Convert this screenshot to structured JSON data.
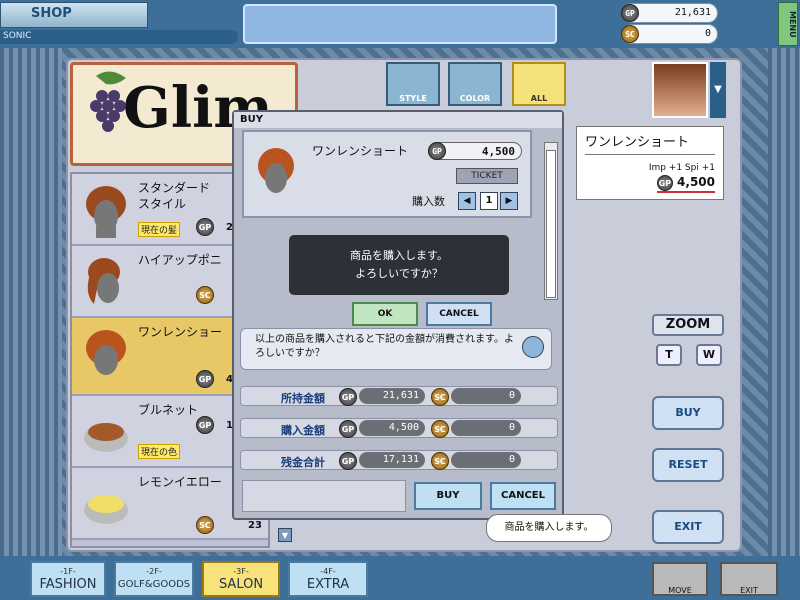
{
  "topbar": {
    "shop_label": "SHOP",
    "player_name": "SONIC",
    "menu_label": "MENU",
    "gp_label": "GP",
    "gp_value": "21,631",
    "sc_label": "SC",
    "sc_value": "0"
  },
  "title_card": {
    "text": "Glim"
  },
  "tabs": [
    {
      "label": "STYLE"
    },
    {
      "label": "COLOR"
    },
    {
      "label": "ALL"
    }
  ],
  "items": [
    {
      "name": "スタンダード\nスタイル",
      "badge": "現在の髪",
      "coin": "GP",
      "price": "2"
    },
    {
      "name": "ハイアップポニ",
      "badge": "",
      "coin": "SC",
      "price": ""
    },
    {
      "name": "ワンレンショー",
      "badge": "",
      "coin": "GP",
      "price": "4"
    },
    {
      "name": "ブルネット",
      "badge": "現在の色",
      "coin": "GP",
      "price": "1"
    },
    {
      "name": "レモンイエロー",
      "badge": "",
      "coin": "SC",
      "price": "23"
    }
  ],
  "info_card": {
    "name": "ワンレンショート",
    "stats": "Imp +1 Spi +1",
    "coin": "GP",
    "price": "4,500"
  },
  "right": {
    "zoom": "ZOOM",
    "t": "T",
    "w": "W",
    "buy": "BUY",
    "reset": "RESET",
    "exit": "EXIT"
  },
  "dialog": {
    "title": "BUY",
    "product_name": "ワンレンショート",
    "coin": "GP",
    "product_price": "4,500",
    "ticket": "TICKET",
    "qty_label": "購入数",
    "qty": "1",
    "confirm_text": "商品を購入します。\nよろしいですか？",
    "ok": "OK",
    "cancel": "CANCEL",
    "summary_note": "以上の商品を購入されると下記の金額が消費されます。よろしいですか？",
    "rows": [
      {
        "label": "所持金額",
        "gp": "21,631",
        "sc": "0"
      },
      {
        "label": "購入金額",
        "gp": "4,500",
        "sc": "0"
      },
      {
        "label": "残金合計",
        "gp": "17,131",
        "sc": "0"
      }
    ],
    "buy": "BUY",
    "cancel2": "CANCEL"
  },
  "tooltip": "商品を購入します。",
  "floors": [
    {
      "num": "-1F-",
      "name": "FASHION"
    },
    {
      "num": "-2F-",
      "name": "GOLF&GOODS"
    },
    {
      "num": "-3F-",
      "name": "SALON"
    },
    {
      "num": "-4F-",
      "name": "EXTRA"
    }
  ],
  "bottom_buttons": {
    "move": "MOVE",
    "exit": "EXIT"
  }
}
